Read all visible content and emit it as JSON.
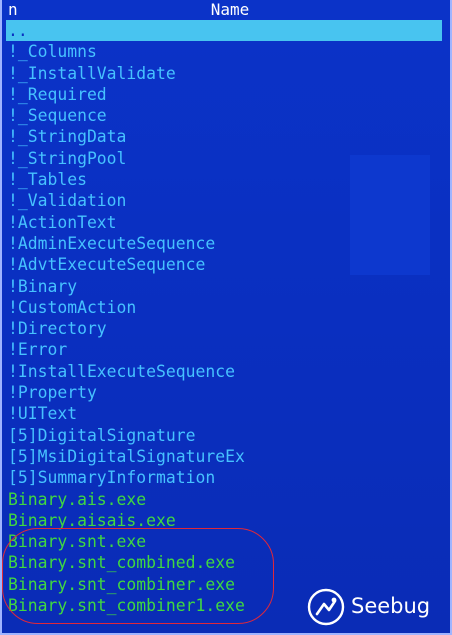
{
  "header": {
    "col_n": "n",
    "col_name": "Name"
  },
  "files": [
    {
      "name": "..",
      "kind": "parent",
      "selected": true
    },
    {
      "name": "!_Columns",
      "kind": "stream"
    },
    {
      "name": "!_InstallValidate",
      "kind": "stream"
    },
    {
      "name": "!_Required",
      "kind": "stream"
    },
    {
      "name": "!_Sequence",
      "kind": "stream"
    },
    {
      "name": "!_StringData",
      "kind": "stream"
    },
    {
      "name": "!_StringPool",
      "kind": "stream"
    },
    {
      "name": "!_Tables",
      "kind": "stream"
    },
    {
      "name": "!_Validation",
      "kind": "stream"
    },
    {
      "name": "!ActionText",
      "kind": "stream"
    },
    {
      "name": "!AdminExecuteSequence",
      "kind": "stream"
    },
    {
      "name": "!AdvtExecuteSequence",
      "kind": "stream"
    },
    {
      "name": "!Binary",
      "kind": "stream"
    },
    {
      "name": "!CustomAction",
      "kind": "stream"
    },
    {
      "name": "!Directory",
      "kind": "stream"
    },
    {
      "name": "!Error",
      "kind": "stream"
    },
    {
      "name": "!InstallExecuteSequence",
      "kind": "stream"
    },
    {
      "name": "!Property",
      "kind": "stream"
    },
    {
      "name": "!UIText",
      "kind": "stream"
    },
    {
      "name": "[5]DigitalSignature",
      "kind": "stream"
    },
    {
      "name": "[5]MsiDigitalSignatureEx",
      "kind": "stream"
    },
    {
      "name": "[5]SummaryInformation",
      "kind": "stream"
    },
    {
      "name": "Binary.ais.exe",
      "kind": "exe"
    },
    {
      "name": "Binary.aisais.exe",
      "kind": "exe"
    },
    {
      "name": "Binary.snt.exe",
      "kind": "exe",
      "highlighted": true
    },
    {
      "name": "Binary.snt_combined.exe",
      "kind": "exe",
      "highlighted": true
    },
    {
      "name": "Binary.snt_combiner.exe",
      "kind": "exe",
      "highlighted": true
    },
    {
      "name": "Binary.snt_combiner1.exe",
      "kind": "exe",
      "highlighted": true
    }
  ],
  "colors": {
    "panel_bg": "#0a2fc0",
    "stream_text": "#46c2ff",
    "exe_text": "#40d840",
    "selection_bg": "#48c4f0",
    "highlight_circle": "#e0283a"
  },
  "watermark": {
    "brand": "Seebug",
    "icon": "seebug-logo-icon"
  }
}
